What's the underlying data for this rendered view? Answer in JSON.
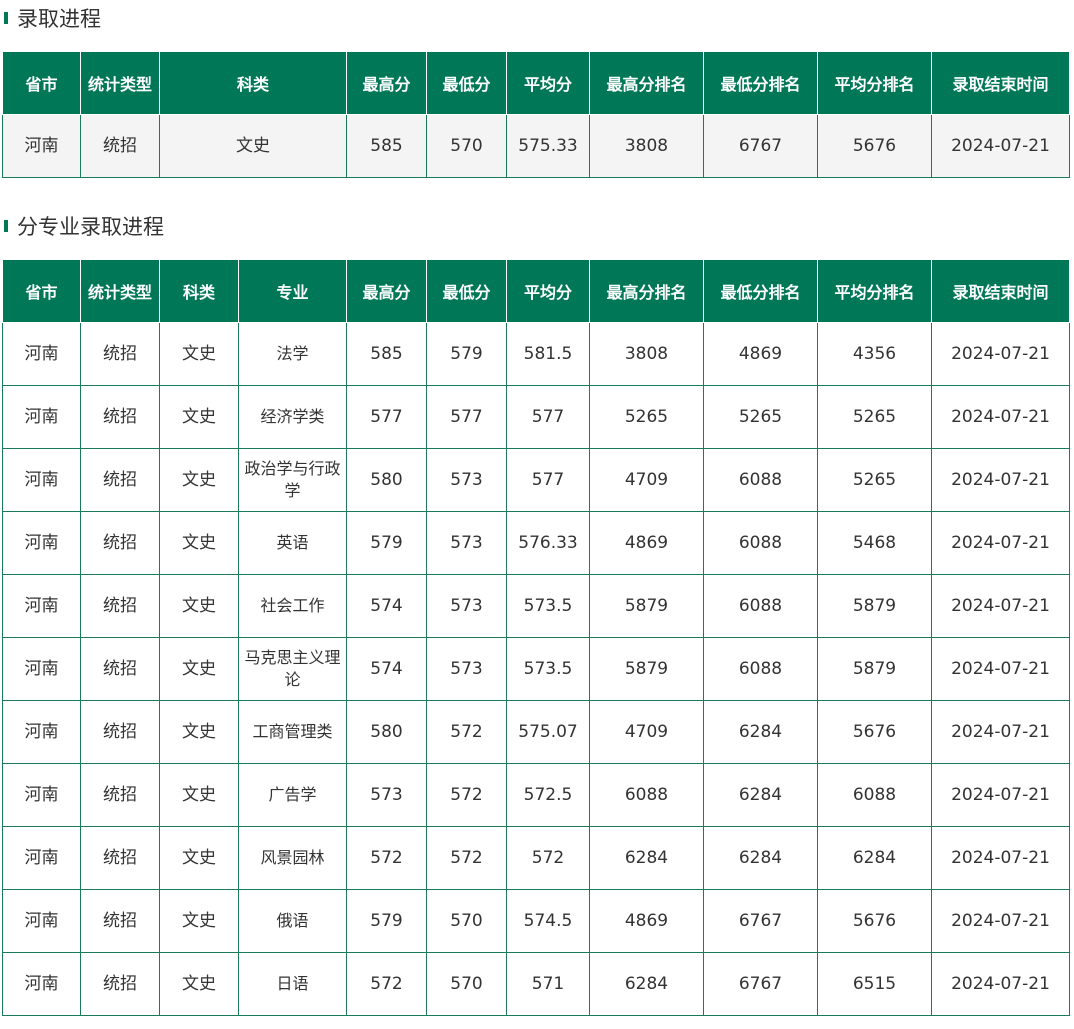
{
  "colors": {
    "header_bg": "#007757",
    "border": "#1a7a5a",
    "bullet": "#007757"
  },
  "section1": {
    "title": "录取进程",
    "headers": [
      "省市",
      "统计类型",
      "科类",
      "最高分",
      "最低分",
      "平均分",
      "最高分排名",
      "最低分排名",
      "平均分排名",
      "录取结束时间"
    ],
    "rows": [
      [
        "河南",
        "统招",
        "文史",
        "585",
        "570",
        "575.33",
        "3808",
        "6767",
        "5676",
        "2024-07-21"
      ]
    ]
  },
  "section2": {
    "title": "分专业录取进程",
    "headers": [
      "省市",
      "统计类型",
      "科类",
      "专业",
      "最高分",
      "最低分",
      "平均分",
      "最高分排名",
      "最低分排名",
      "平均分排名",
      "录取结束时间"
    ],
    "rows": [
      [
        "河南",
        "统招",
        "文史",
        "法学",
        "585",
        "579",
        "581.5",
        "3808",
        "4869",
        "4356",
        "2024-07-21"
      ],
      [
        "河南",
        "统招",
        "文史",
        "经济学类",
        "577",
        "577",
        "577",
        "5265",
        "5265",
        "5265",
        "2024-07-21"
      ],
      [
        "河南",
        "统招",
        "文史",
        "政治学与行政学",
        "580",
        "573",
        "577",
        "4709",
        "6088",
        "5265",
        "2024-07-21"
      ],
      [
        "河南",
        "统招",
        "文史",
        "英语",
        "579",
        "573",
        "576.33",
        "4869",
        "6088",
        "5468",
        "2024-07-21"
      ],
      [
        "河南",
        "统招",
        "文史",
        "社会工作",
        "574",
        "573",
        "573.5",
        "5879",
        "6088",
        "5879",
        "2024-07-21"
      ],
      [
        "河南",
        "统招",
        "文史",
        "马克思主义理论",
        "574",
        "573",
        "573.5",
        "5879",
        "6088",
        "5879",
        "2024-07-21"
      ],
      [
        "河南",
        "统招",
        "文史",
        "工商管理类",
        "580",
        "572",
        "575.07",
        "4709",
        "6284",
        "5676",
        "2024-07-21"
      ],
      [
        "河南",
        "统招",
        "文史",
        "广告学",
        "573",
        "572",
        "572.5",
        "6088",
        "6284",
        "6088",
        "2024-07-21"
      ],
      [
        "河南",
        "统招",
        "文史",
        "风景园林",
        "572",
        "572",
        "572",
        "6284",
        "6284",
        "6284",
        "2024-07-21"
      ],
      [
        "河南",
        "统招",
        "文史",
        "俄语",
        "579",
        "570",
        "574.5",
        "4869",
        "6767",
        "5676",
        "2024-07-21"
      ],
      [
        "河南",
        "统招",
        "文史",
        "日语",
        "572",
        "570",
        "571",
        "6284",
        "6767",
        "6515",
        "2024-07-21"
      ]
    ]
  }
}
